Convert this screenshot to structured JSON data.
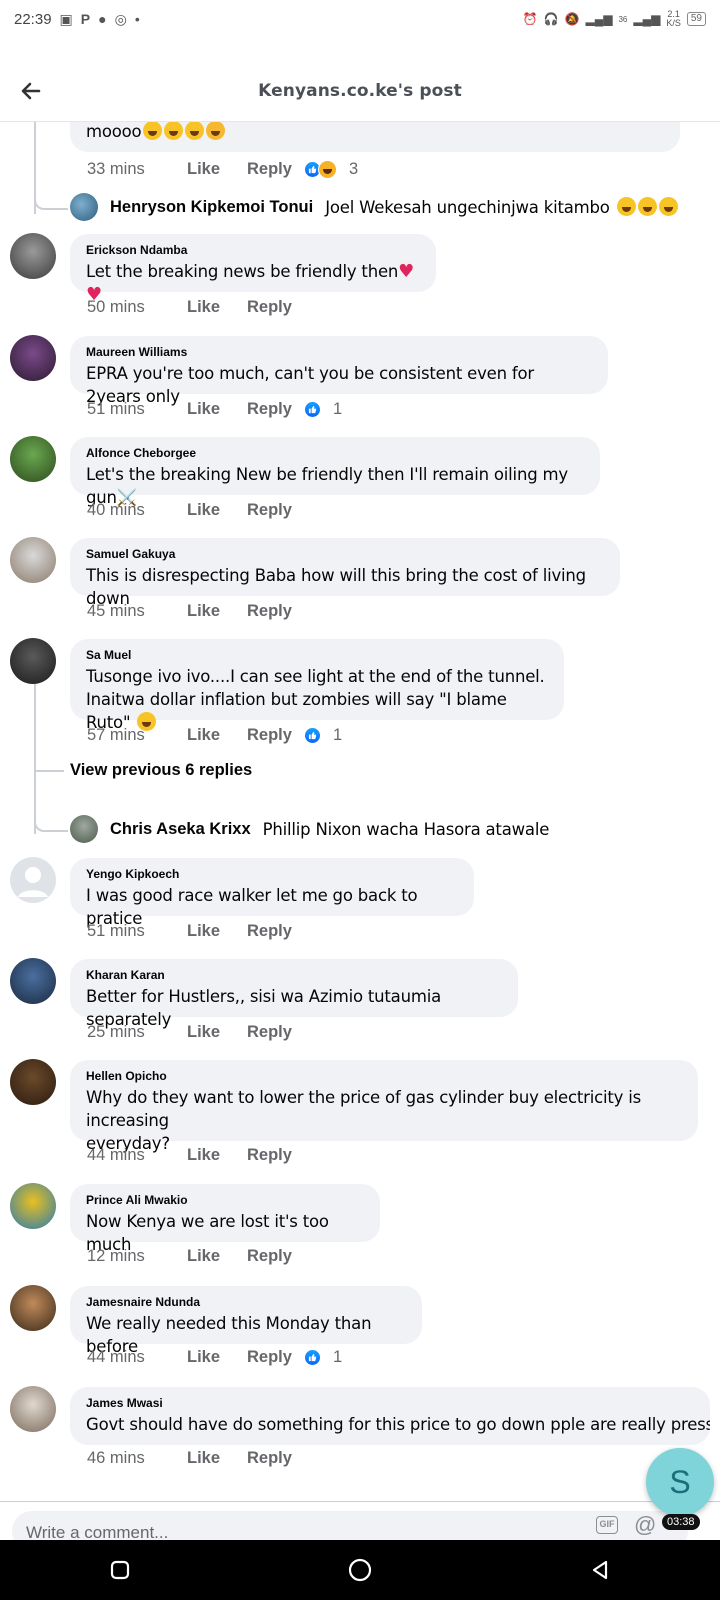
{
  "status_bar": {
    "time": "22:39",
    "speed_top": "36",
    "speed": "2.1",
    "speed_unit": "K/S",
    "battery": "59"
  },
  "header": {
    "title": "Kenyans.co.ke's post"
  },
  "top_partial": {
    "text": "moooo",
    "time": "33 mins",
    "like": "Like",
    "reply": "Reply",
    "reaction_count": "3"
  },
  "reply_henryson": {
    "name": "Henryson Kipkemoi Tonui",
    "text": "Joel Wekesah ungechinjwa kitambo"
  },
  "comments": [
    {
      "name": "Erickson Ndamba",
      "text": "Let the breaking news be friendly then",
      "time": "50 mins",
      "like": "Like",
      "reply": "Reply"
    },
    {
      "name": "Maureen Williams",
      "text": "EPRA you're too much, can't you be consistent even for 2years only",
      "time": "51 mins",
      "like": "Like",
      "reply": "Reply",
      "count": "1"
    },
    {
      "name": "Alfonce Cheborgee",
      "text": "Let's the breaking New be friendly then I'll remain oiling my gun⚔️",
      "time": "40 mins",
      "like": "Like",
      "reply": "Reply"
    },
    {
      "name": "Samuel Gakuya",
      "text": "This is disrespecting Baba how will this bring the cost of living down",
      "time": "45 mins",
      "like": "Like",
      "reply": "Reply"
    },
    {
      "name": "Sa Muel",
      "text": "Tusonge ivo ivo....I can see light at the end of the tunnel.",
      "text2": "Inaitwa dollar inflation but zombies will say \"I blame Ruto\"",
      "time": "57 mins",
      "like": "Like",
      "reply": "Reply",
      "count": "1"
    },
    {
      "name": "Yengo Kipkoech",
      "text": "I was good race walker let me go back to pratice",
      "time": "51 mins",
      "like": "Like",
      "reply": "Reply"
    },
    {
      "name": "Kharan Karan",
      "text": "Better for Hustlers,, sisi wa Azimio tutaumia separately",
      "time": "25 mins",
      "like": "Like",
      "reply": "Reply"
    },
    {
      "name": "Hellen Opicho",
      "text": "Why do they want to lower the price of gas cylinder buy electricity is increasing",
      "text2": "everyday?",
      "time": "44 mins",
      "like": "Like",
      "reply": "Reply"
    },
    {
      "name": "Prince Ali Mwakio",
      "text": "Now Kenya we are lost it's too much",
      "time": "12 mins",
      "like": "Like",
      "reply": "Reply"
    },
    {
      "name": "Jamesnaire Ndunda",
      "text": "We really needed this Monday than before",
      "time": "44 mins",
      "like": "Like",
      "reply": "Reply",
      "count": "1"
    },
    {
      "name": "James Mwasi",
      "text": "Govt should have do something for this price to go down pple are really pressed",
      "time": "46 mins",
      "like": "Like",
      "reply": "Reply"
    }
  ],
  "view_previous": "View previous 6 replies",
  "reply_chris": {
    "name": "Chris Aseka Krixx",
    "text": "Phillip Nixon wacha Hasora atawale"
  },
  "comment_input": {
    "placeholder": "Write a comment..."
  },
  "gif_label": "GIF",
  "float_bubble": {
    "letter": "S",
    "timer": "03:38"
  },
  "colors": {
    "bubble": "#f0f2f5",
    "like_blue": "#0866ff",
    "meta_gray": "#65676b"
  }
}
